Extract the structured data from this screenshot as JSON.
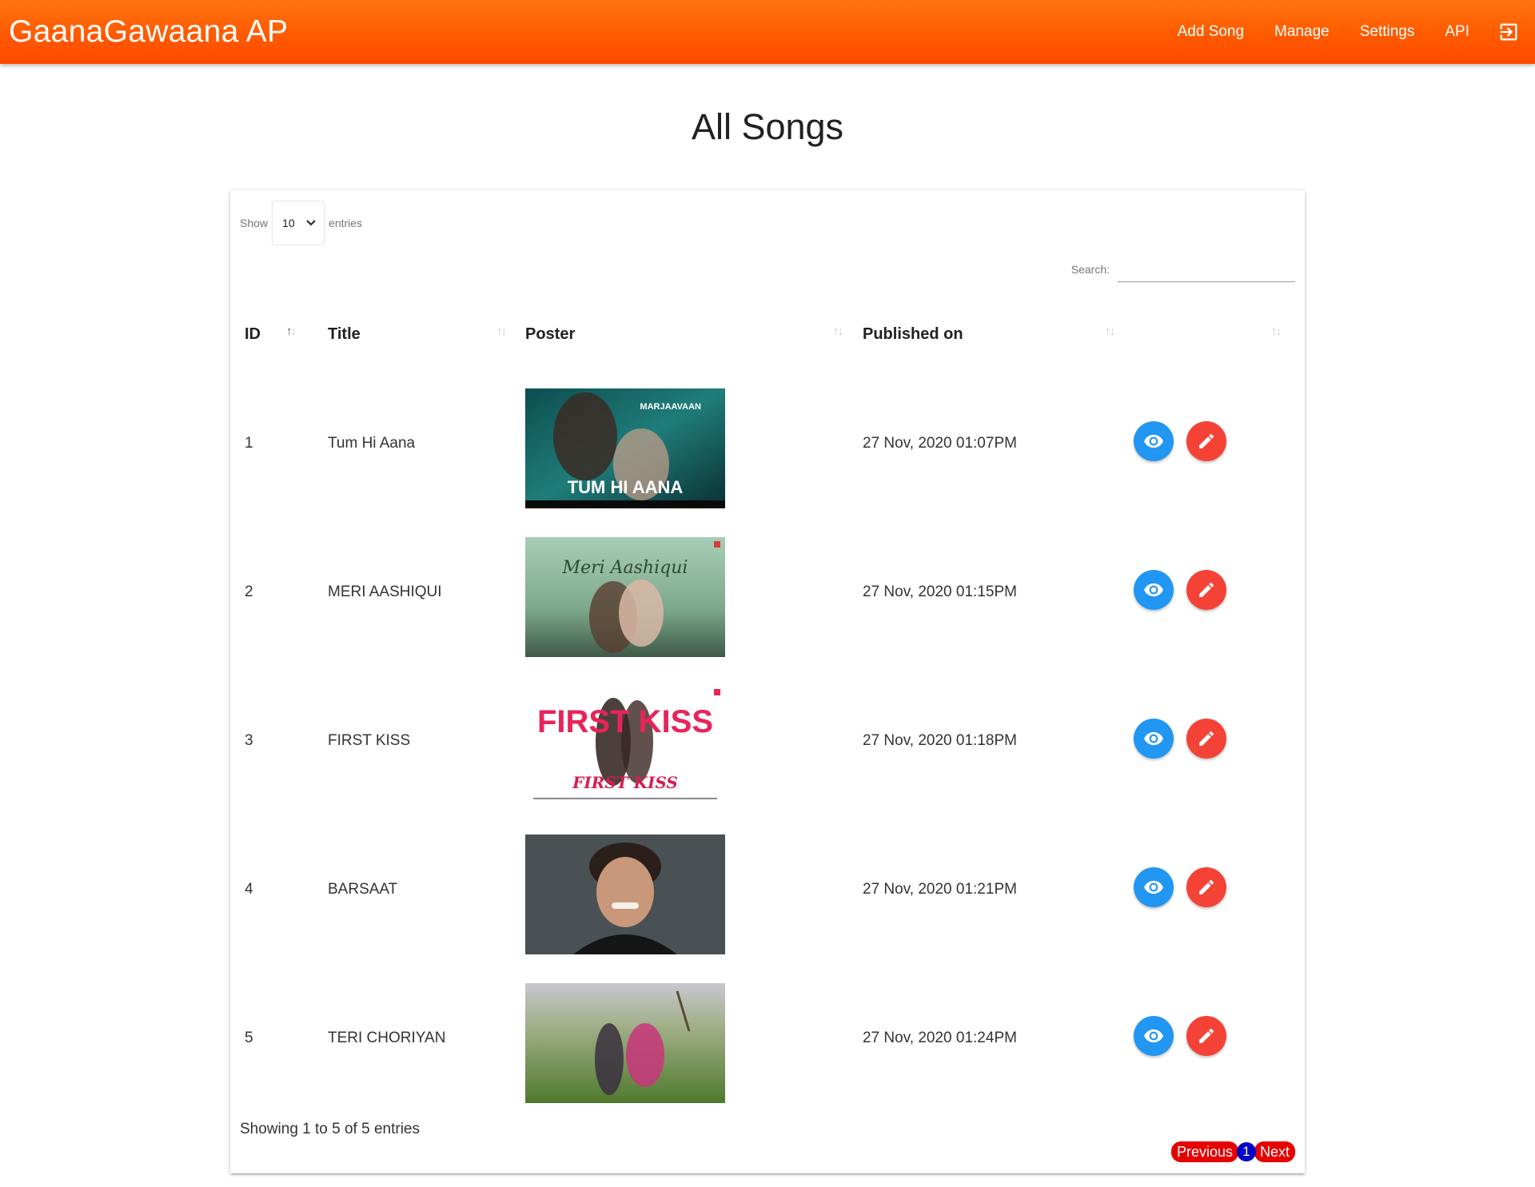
{
  "navbar": {
    "brand": "GaanaGawaana AP",
    "links": [
      "Add Song",
      "Manage",
      "Settings",
      "API"
    ],
    "logout_icon": "logout-icon"
  },
  "page": {
    "title": "All Songs"
  },
  "table_controls": {
    "show_label": "Show",
    "entries_value": "10",
    "entries_label": "entries",
    "search_label": "Search:",
    "search_value": ""
  },
  "table": {
    "columns": [
      "ID",
      "Title",
      "Poster",
      "Published on",
      ""
    ],
    "sort_icon": "↑↓",
    "rows": [
      {
        "id": "1",
        "title": "Tum Hi Aana",
        "poster_text": "TUM HI AANA",
        "poster_sub": "MARJAAVAAN",
        "published": "27 Nov, 2020 01:07PM"
      },
      {
        "id": "2",
        "title": "MERI AASHIQUI",
        "poster_text": "Meri Aashiqui",
        "poster_sub": "",
        "published": "27 Nov, 2020 01:15PM"
      },
      {
        "id": "3",
        "title": "FIRST KISS",
        "poster_text": "FIRST KISS",
        "poster_sub": "FIRST KISS",
        "published": "27 Nov, 2020 01:18PM"
      },
      {
        "id": "4",
        "title": "BARSAAT",
        "poster_text": "",
        "poster_sub": "",
        "published": "27 Nov, 2020 01:21PM"
      },
      {
        "id": "5",
        "title": "TERI CHORIYAN",
        "poster_text": "",
        "poster_sub": "",
        "published": "27 Nov, 2020 01:24PM"
      }
    ],
    "view_icon": "eye-icon",
    "edit_icon": "pencil-icon"
  },
  "footer": {
    "info": "Showing 1 to 5 of 5 entries",
    "previous": "Previous",
    "page": "1",
    "next": "Next"
  },
  "colors": {
    "navbar": "#ff5a00",
    "view_button": "#2196f3",
    "edit_button": "#f44336",
    "pagination_button": "#e60000",
    "pagination_current": "#0000c8"
  }
}
